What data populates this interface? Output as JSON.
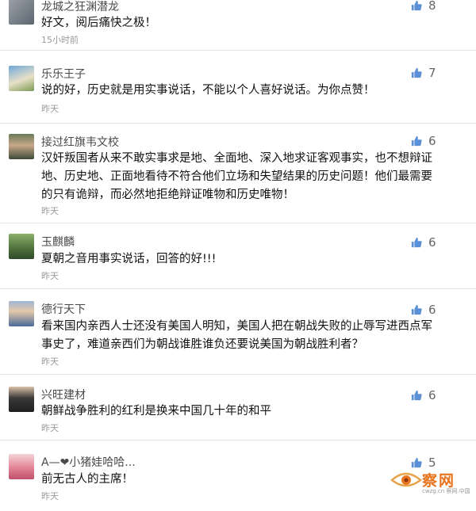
{
  "comments": [
    {
      "user": "龙城之狂渊潜龙",
      "text": "好文，阅后痛快之极！",
      "time": "15小时前",
      "likes": "8"
    },
    {
      "user": "乐乐王子",
      "text": "说的好，历史就是用实事说话，不能以个人喜好说话。为你点赞！",
      "time": "昨天",
      "likes": "7"
    },
    {
      "user": "接过红旗韦文校",
      "text": "汉奸叛国者从来不敢实事求是地、全面地、深入地求证客观事实，也不想辩证地、历史地、正面地看待不符合他们立场和失望结果的历史问题！他们最需要的只有诡辩，而必然地拒绝辩证唯物和历史唯物！",
      "time": "昨天",
      "likes": "6"
    },
    {
      "user": "玉麒麟",
      "text": "夏朝之音用事实说话，回答的好!!!",
      "time": "昨天",
      "likes": "6"
    },
    {
      "user": "德行天下",
      "text": "看来国内亲西人士还没有美国人明知，美国人把在朝战失败的止辱写进西点军事史了，难道亲西们为朝战谁胜谁负还要说美国为朝战胜利者？",
      "time": "昨天",
      "likes": "6"
    },
    {
      "user": "兴旺建材",
      "text": "朝鲜战争胜利的红利是换来中国几十年的和平",
      "time": "昨天",
      "likes": "6"
    },
    {
      "user": "A—❤小猪娃哈哈...",
      "text": "前无古人的主席！",
      "time": "昨天",
      "likes": "5"
    }
  ],
  "watermark": {
    "name": "察网",
    "domain": "cwzg.cn 察网.中国"
  },
  "colors": {
    "like_icon": "#5b8fd6",
    "time": "#9a9a9a",
    "watermark": "#e8741e"
  }
}
